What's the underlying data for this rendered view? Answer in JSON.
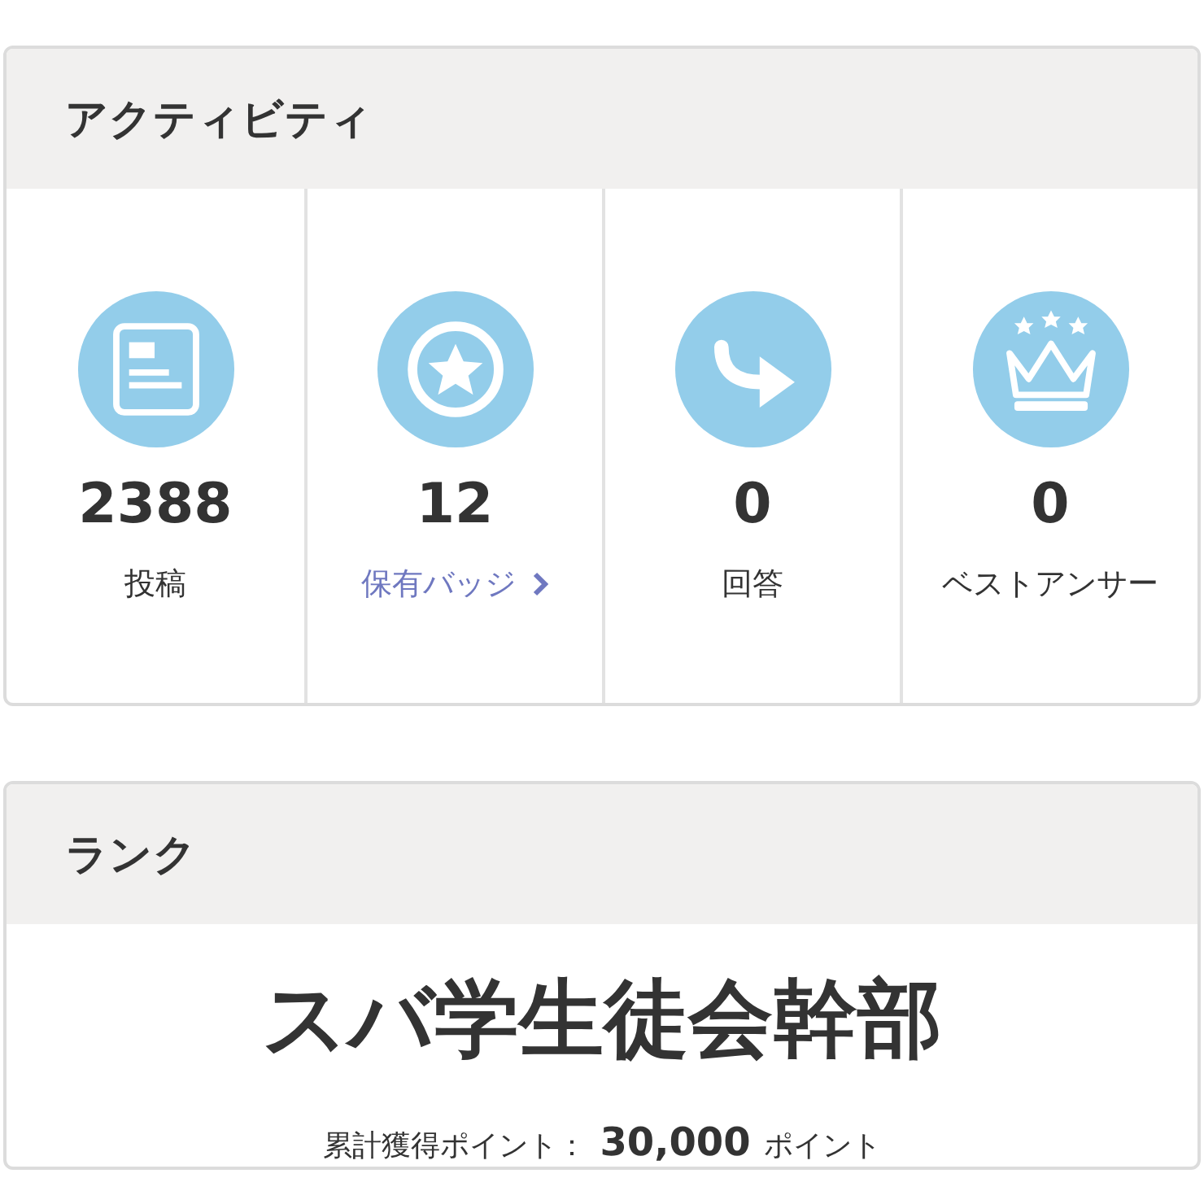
{
  "activity": {
    "title": "アクティビティ",
    "stats": [
      {
        "value": "2388",
        "label": "投稿",
        "kind": "text"
      },
      {
        "value": "12",
        "label": "保有バッジ",
        "kind": "link"
      },
      {
        "value": "0",
        "label": "回答",
        "kind": "text"
      },
      {
        "value": "0",
        "label": "ベストアンサー",
        "kind": "text"
      }
    ]
  },
  "rank": {
    "title": "ランク",
    "name": "スバ学生徒会幹部",
    "points_label": "累計獲得ポイント：",
    "points": "30,000",
    "points_unit": "ポイント"
  }
}
